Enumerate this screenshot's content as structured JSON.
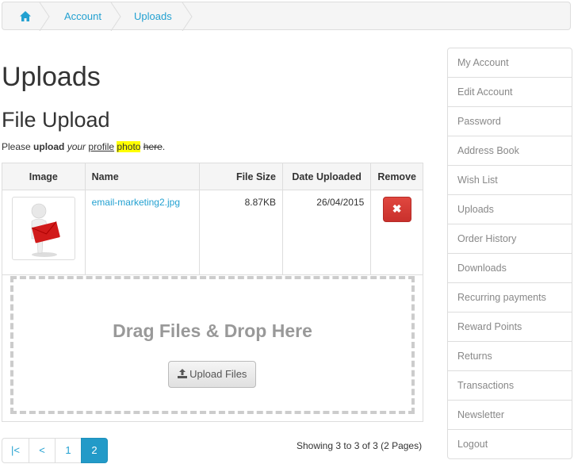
{
  "breadcrumb": {
    "home_icon": "home-icon",
    "items": [
      "Account",
      "Uploads"
    ]
  },
  "page_title": "Uploads",
  "section_title": "File Upload",
  "intro": {
    "please": "Please ",
    "upload": "upload",
    "your": "your",
    "profile": "profile",
    "photo": "photo",
    "here": "here",
    "end": "."
  },
  "table": {
    "headers": [
      "Image",
      "Name",
      "File Size",
      "Date Uploaded",
      "Remove"
    ],
    "rows": [
      {
        "name": "email-marketing2.jpg",
        "size": "8.87KB",
        "date": "26/04/2015",
        "remove_icon": "close-icon"
      }
    ]
  },
  "dropzone": {
    "title": "Drag Files & Drop Here",
    "button_label": "Upload Files",
    "button_icon": "upload-icon"
  },
  "pagination": {
    "first": "|<",
    "prev": "<",
    "pages": [
      "1",
      "2"
    ],
    "active": "2",
    "showing": "Showing 3 to 3 of 3 (2 Pages)"
  },
  "menu": {
    "items": [
      "My Account",
      "Edit Account",
      "Password",
      "Address Book",
      "Wish List",
      "Uploads",
      "Order History",
      "Downloads",
      "Recurring payments",
      "Reward Points",
      "Returns",
      "Transactions",
      "Newsletter",
      "Logout"
    ]
  },
  "colors": {
    "link": "#23a1d1",
    "active_page": "#229ac8",
    "danger": "#d9534f",
    "highlight": "#ffff00"
  }
}
